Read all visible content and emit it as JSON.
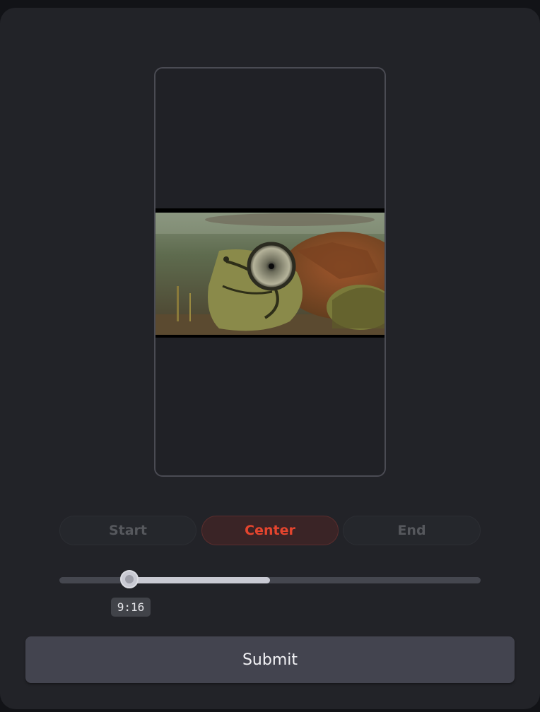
{
  "alignment": {
    "options": [
      {
        "label": "Start",
        "selected": false
      },
      {
        "label": "Center",
        "selected": true
      },
      {
        "label": "End",
        "selected": false
      }
    ],
    "selected_color": "#e5452e"
  },
  "ratio_slider": {
    "value_label": "9:16"
  },
  "submit": {
    "label": "Submit"
  },
  "preview": {
    "image_subject": "turtle-photo"
  }
}
